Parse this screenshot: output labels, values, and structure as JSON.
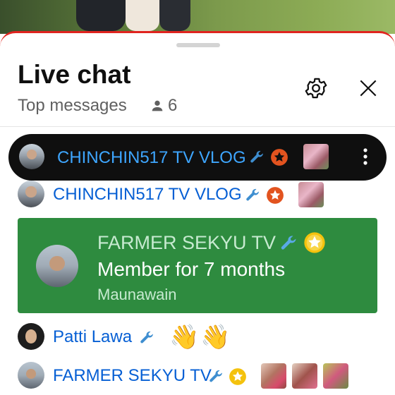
{
  "header": {
    "title": "Live chat",
    "mode_label": "Top messages",
    "viewer_count": "6"
  },
  "icons": {
    "settings": "gear-icon",
    "close": "close-icon",
    "viewers": "person-icon",
    "moderator": "wrench-icon",
    "member_badge": "star-badge-icon",
    "more": "more-vert-icon"
  },
  "colors": {
    "accent_red": "#e0241f",
    "author_link": "#065fd4",
    "pinned_author": "#3ea6ff",
    "member_card": "#2e8b3f",
    "moderator_badge": "#3e8ed0",
    "member_star_orange": "#e2531f",
    "member_star_gold": "#f4c20d",
    "emoji_pink": "#e8317d"
  },
  "pinned_message": {
    "author": "CHINCHIN517 TV VLOG"
  },
  "messages": [
    {
      "author": "CHINCHIN517 TV VLOG"
    },
    {
      "type": "membership",
      "author": "FARMER SEKYU TV",
      "headline": "Member for 7 months",
      "level": "Maunawain"
    },
    {
      "author": "Patti Lawa",
      "content": "👋👋"
    },
    {
      "author": "FARMER SEKYU TV"
    }
  ]
}
